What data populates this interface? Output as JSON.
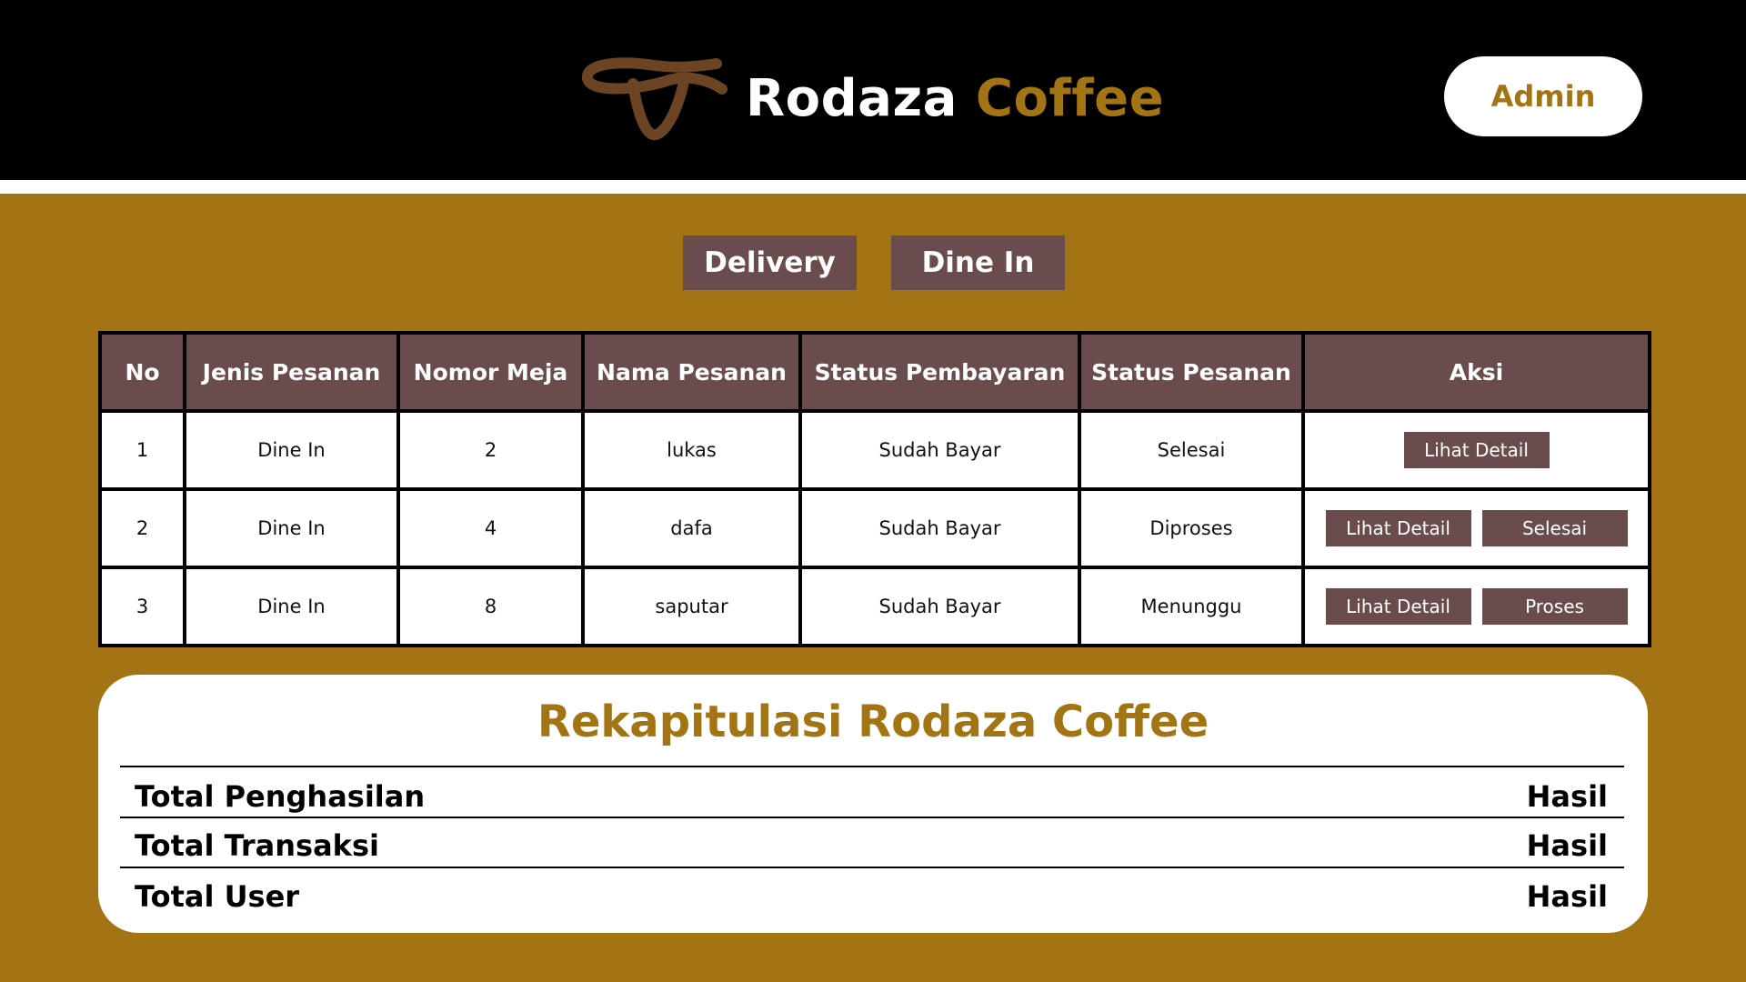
{
  "brand": {
    "name_part1": "Rodaza",
    "name_part2": "Coffee",
    "logo_icon": "coffee-swirl-logo",
    "colors": {
      "accent": "#A37414",
      "logo": "#6B4423",
      "header_bg": "#000000"
    }
  },
  "header": {
    "admin_label": "Admin"
  },
  "tabs": [
    {
      "label": "Delivery"
    },
    {
      "label": "Dine In"
    }
  ],
  "table": {
    "headers": [
      "No",
      "Jenis Pesanan",
      "Nomor Meja",
      "Nama Pesanan",
      "Status Pembayaran",
      "Status Pesanan",
      "Aksi"
    ],
    "rows": [
      {
        "no": "1",
        "jenis": "Dine In",
        "meja": "2",
        "nama": "lukas",
        "bayar": "Sudah Bayar",
        "status": "Selesai",
        "actions": [
          "Lihat Detail"
        ]
      },
      {
        "no": "2",
        "jenis": "Dine In",
        "meja": "4",
        "nama": "dafa",
        "bayar": "Sudah Bayar",
        "status": "Diproses",
        "actions": [
          "Lihat Detail",
          "Selesai"
        ]
      },
      {
        "no": "3",
        "jenis": "Dine In",
        "meja": "8",
        "nama": "saputar",
        "bayar": "Sudah Bayar",
        "status": "Menunggu",
        "actions": [
          "Lihat Detail",
          "Proses"
        ]
      }
    ]
  },
  "recap": {
    "title": "Rekapitulasi Rodaza Coffee",
    "rows": [
      {
        "label": "Total Penghasilan",
        "value": "Hasil"
      },
      {
        "label": "Total Transaksi",
        "value": "Hasil"
      },
      {
        "label": "Total User",
        "value": "Hasil"
      }
    ]
  }
}
